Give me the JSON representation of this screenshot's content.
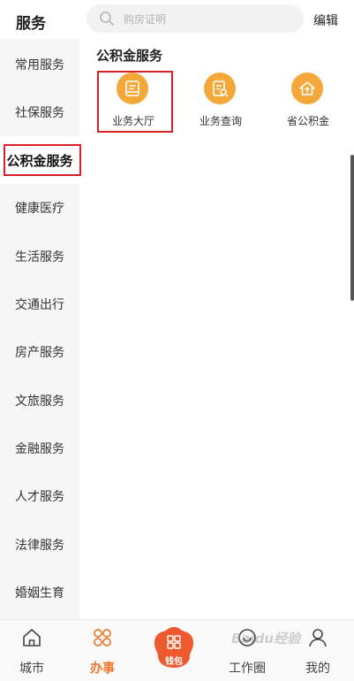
{
  "header": {
    "title": "服务",
    "search_placeholder": "购房证明",
    "edit_label": "编辑"
  },
  "sidebar": {
    "items": [
      {
        "label": "常用服务"
      },
      {
        "label": "社保服务"
      },
      {
        "label": "公积金服务"
      },
      {
        "label": "健康医疗"
      },
      {
        "label": "生活服务"
      },
      {
        "label": "交通出行"
      },
      {
        "label": "房产服务"
      },
      {
        "label": "文旅服务"
      },
      {
        "label": "金融服务"
      },
      {
        "label": "人才服务"
      },
      {
        "label": "法律服务"
      },
      {
        "label": "婚姻生育"
      }
    ],
    "active_index": 2
  },
  "main": {
    "section_title": "公积金服务",
    "services": [
      {
        "label": "业务大厅",
        "icon": "hall-icon"
      },
      {
        "label": "业务查询",
        "icon": "query-icon"
      },
      {
        "label": "省公积金",
        "icon": "house-icon"
      }
    ]
  },
  "tabbar": {
    "tabs": [
      {
        "label": "城市",
        "icon": "home-icon"
      },
      {
        "label": "办事",
        "icon": "grid-icon",
        "active": true
      },
      {
        "label": "工作圈",
        "icon": "chat-icon"
      },
      {
        "label": "我的",
        "icon": "user-icon"
      }
    ],
    "wallet_label": "钱包"
  },
  "colors": {
    "accent": "#f0762e",
    "icon_bg": "#f4a83a",
    "highlight_box": "#d8222a"
  },
  "watermark": "Baidu经验"
}
